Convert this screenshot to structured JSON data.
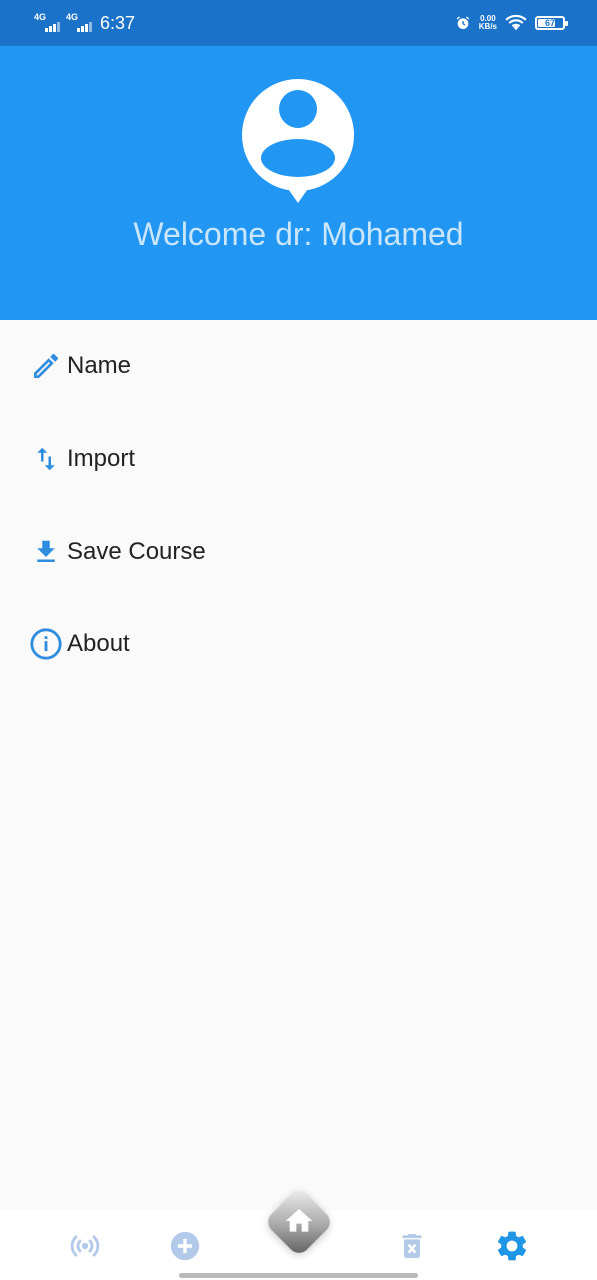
{
  "status_bar": {
    "network_1": "4G",
    "network_2": "4G",
    "time": "6:37",
    "speed_value": "0.00",
    "speed_unit": "KB/s",
    "battery_level": "67",
    "icons": [
      "signal-icon",
      "signal-icon",
      "alarm-icon",
      "wifi-icon",
      "battery-icon"
    ]
  },
  "header": {
    "avatar_icon": "account-pin-icon",
    "welcome_text": "Welcome dr: Mohamed",
    "background_color": "#2196f3"
  },
  "menu": {
    "items": [
      {
        "label": "Name",
        "icon": "pencil-icon"
      },
      {
        "label": "Import",
        "icon": "import-export-icon"
      },
      {
        "label": "Save Course",
        "icon": "download-icon"
      },
      {
        "label": "About",
        "icon": "info-icon"
      }
    ],
    "icon_color": "#2f8ddf"
  },
  "bottom_nav": {
    "items": [
      {
        "icon": "broadcast-icon",
        "active": false
      },
      {
        "icon": "add-circle-icon",
        "active": false
      },
      {
        "icon": "home-icon",
        "active": false
      },
      {
        "icon": "delete-icon",
        "active": false
      },
      {
        "icon": "settings-icon",
        "active": true
      }
    ],
    "inactive_color": "#b3c9ea",
    "active_color": "#1f95e6"
  }
}
